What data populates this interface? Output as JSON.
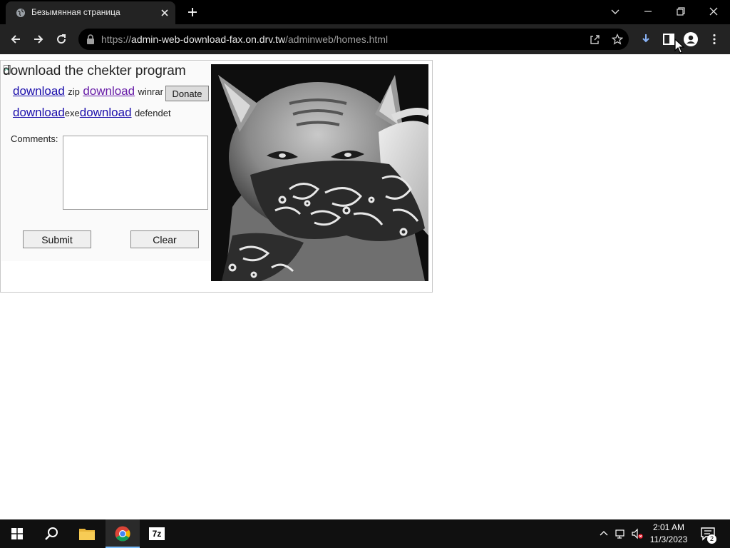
{
  "browser": {
    "tab_title": "Безымянная страница",
    "url_scheme": "https://",
    "url_host": "admin-web-download-fax.on.drv.tw",
    "url_path": "/adminweb/homes.html"
  },
  "page": {
    "image_alt": "download the chekter program",
    "links": [
      {
        "label": "download",
        "suffix": "zip"
      },
      {
        "label": "download",
        "suffix": "winrar"
      },
      {
        "label": "download",
        "suffix": "exe"
      },
      {
        "label": "download",
        "suffix": "defendet"
      }
    ],
    "donate_label": "Donate",
    "comments_label": "Comments:",
    "comments_value": "",
    "submit_label": "Submit",
    "clear_label": "Clear"
  },
  "taskbar": {
    "time": "2:01 AM",
    "date": "11/3/2023",
    "notification_count": "2",
    "sevenzip_label": "7z"
  },
  "colors": {
    "link": "#1a0dab",
    "visited_link": "#681da8",
    "chrome_dark": "#232323"
  },
  "icons": [
    "globe-icon",
    "close-icon",
    "plus-icon",
    "back-icon",
    "forward-icon",
    "reload-icon",
    "lock-icon",
    "share-icon",
    "star-icon",
    "download-icon",
    "sidebar-icon",
    "profile-icon",
    "menu-icon",
    "windows-icon",
    "search-icon",
    "folder-icon",
    "chrome-icon",
    "sevenzip-icon"
  ]
}
